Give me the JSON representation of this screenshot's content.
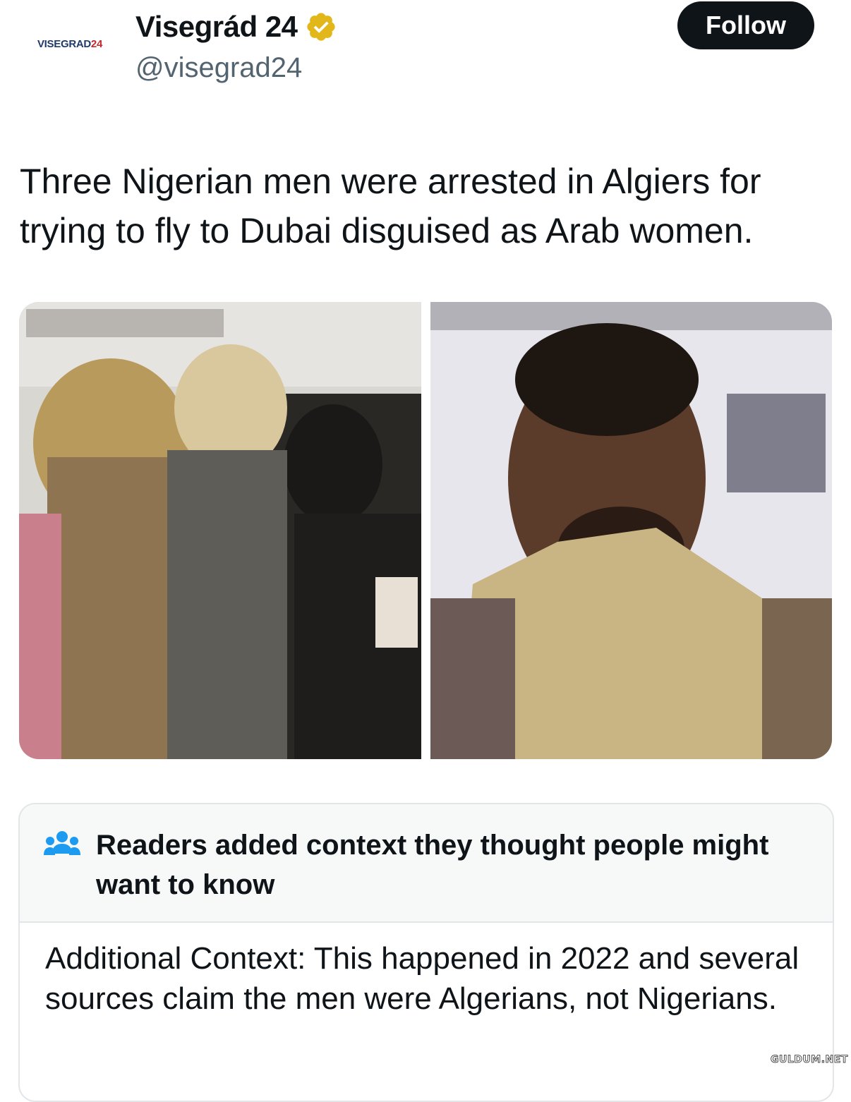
{
  "account": {
    "avatar_logo": "VISEGRAD24",
    "avatar_logo_main": "VISEGRAD",
    "avatar_logo_accent": "24",
    "display_name": "Visegrád 24",
    "verified_icon": "verified-badge-icon",
    "verified_color": "#e2b719",
    "handle": "@visegrad24",
    "follow_label": "Follow"
  },
  "tweet": {
    "text": "Three Nigerian men were arrested in Algiers for trying to fly to Dubai disguised as Arab women."
  },
  "media": {
    "count": 2
  },
  "community_note": {
    "icon": "people-icon",
    "icon_color": "#1d9bf0",
    "title": "Readers added context they thought people might want to know",
    "body": "Additional Context: This happened in 2022 and several sources claim the men were Algerians, not Nigerians."
  },
  "watermark": "GULDUM.NET",
  "colors": {
    "follow_bg": "#0f1419",
    "text": "#0f1419",
    "secondary": "#536471"
  }
}
